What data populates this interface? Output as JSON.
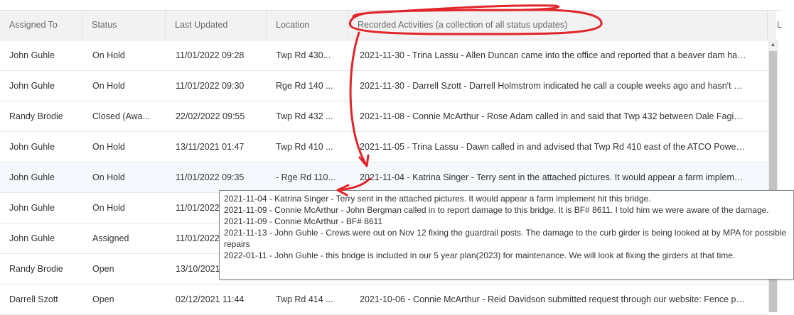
{
  "columns": [
    "Assigned To",
    "Status",
    "Last Updated",
    "Location",
    "Recorded Activities (a collection of all status updates)",
    "L"
  ],
  "rows": [
    {
      "assigned": "John Guhle",
      "status": "On Hold",
      "updated": "11/01/2022 09:28",
      "location": "Twp Rd 430...",
      "activity": "2021-11-30 - Trina Lassu - Allen Duncan came into the office and reported that a beaver dam has b..."
    },
    {
      "assigned": "John Guhle",
      "status": "On Hold",
      "updated": "11/01/2022 09:30",
      "location": "Rge Rd 140 ...",
      "activity": "2021-11-30 - Darrell Szott - Darrell Holmstrom indicated he call a couple weeks ago and hasn't hear..."
    },
    {
      "assigned": "Randy Brodie",
      "status": "Closed (Awa...",
      "updated": "22/02/2022 09:55",
      "location": "Twp Rd 432 ...",
      "activity": "2021-11-08 - Connie McArthur - Rose Adam called in and said that Twp 432 between Dale Fagin an..."
    },
    {
      "assigned": "John Guhle",
      "status": "On Hold",
      "updated": "13/11/2021 01:47",
      "location": "Twp Rd 410 ...",
      "activity": "2021-11-05 - Trina Lassu - Dawn called in and advised that Twp Rd 410 east of the ATCO Power Pla..."
    },
    {
      "assigned": "John Guhle",
      "status": "On Hold",
      "updated": "11/01/2022 09:35",
      "location": "- Rge Rd 110...",
      "activity": "2021-11-04 - Katrina Singer - Terry sent in the attached pictures. It would appear a farm implement..."
    },
    {
      "assigned": "John Guhle",
      "status": "On Hold",
      "updated": "11/01/2022",
      "location": "",
      "activity": ""
    },
    {
      "assigned": "John Guhle",
      "status": "Assigned",
      "updated": "11/01/2022",
      "location": "",
      "activity": ""
    },
    {
      "assigned": "Randy Brodie",
      "status": "Open",
      "updated": "13/10/2021",
      "location": "",
      "activity": ""
    },
    {
      "assigned": "Darrell Szott",
      "status": "Open",
      "updated": "02/12/2021 11:44",
      "location": "Twp Rd 414 ...",
      "activity": "2021-10-06 - Connie McArthur - Reid Davidson submitted request through our website: Fence post..."
    }
  ],
  "tooltip": [
    "2021-11-04 - Katrina Singer - Terry sent in the attached pictures. It would appear a farm implement hit this bridge.",
    "2021-11-09 - Connie McArthur - John Bergman called in to report damage to this bridge. It is BF# 8611. I told him we were aware of the damage.",
    "2021-11-09 - Connie McArthur - BF# 8611",
    "2021-11-13 - John Guhle - Crews were out on Nov 12 fixing the guardrail posts. The damage to the curb girder is being looked at by MPA for possible repairs",
    "2022-01-11 - John Guhle - this bridge is included in our 5 year plan(2023) for maintenance. We will look at fixing the girders at that time."
  ],
  "scrollbar": {
    "up_glyph": "▲"
  },
  "colors": {
    "annotation": "#e0262a",
    "header_bg": "#f2f2f2",
    "hover_row": "#f5f9fd"
  }
}
